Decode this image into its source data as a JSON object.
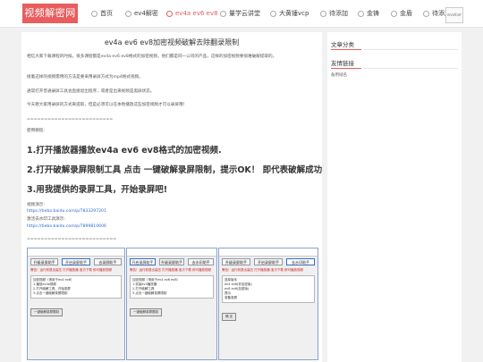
{
  "logo": "视频解密网",
  "nav": [
    "首页",
    "ev4解密",
    "ev4a ev6 ev8",
    "量学云讲堂",
    "大黄锤vcp",
    "待添加",
    "金铸",
    "金盾",
    "待添加"
  ],
  "avatar_alt": "avatar",
  "article": {
    "title": "ev4a ev6 ev8加密视频破解去除翻录限制",
    "para1": "相信大家下载课程的时候，很多课程都是ev4a ev6 ev8格式的加密视频，他们都是同一公司的产品，这样的加密视频要很难破解提取的。",
    "para2": "接着这样的视频需用的方法是要采用录屏方式为mp4格式视频。",
    "para3": "通常打开普通录屏工具会直接退出程序，或者是出来视频是黑屏状态。",
    "para4": "今天教大家用录屏的方式来提取，但是必须可以在本地播放这些加密视频才可以录屏哦！",
    "sep1": "=========================",
    "tutorial": "使用教程:",
    "step1": "1.打开播放器播放ev4a ev6 ev8格式的加密视频.",
    "step2": "2.打开破解录屏限制工具 点击 一键破解录屏限制，提示OK！ 即代表破解成功!",
    "step3": "3.用我提供的录屏工具，开始录屏吧!",
    "demo_label": "视频演示:",
    "demo_url": "https://tieba.baidu.com/p/7833297201",
    "tool_label": "激活去水印工具演示:",
    "tool_url": "https://tieba.baidu.com/p/7899810606",
    "sep2": "=========================="
  },
  "screens": [
    {
      "tabs": [
        "升级录屏助手",
        "开启录屏助手",
        "去录屏助手"
      ],
      "notice": "警告！运行前退出高压 打开播放器-宝贝下载 即可播放视频",
      "lines": [
        "加密视频（请用于ev4 ev6）",
        "1.播放ev4a视频",
        "2.打开破解工具，开始录屏",
        "3.点击一键破解录屏限制"
      ],
      "button": "一键破解录屏限制"
    },
    {
      "tabs": [
        "开启录屏助手",
        "升级录屏助手",
        "去水印助手"
      ],
      "notice": "警告！运行前退出高压 打开播放器-宝贝下载 即可播放视频",
      "lines": [
        "加密视频（请用于ev4 ev6 ev8）",
        "1.安装ev4播放器",
        "2.打开破解工具",
        "3.点击一键破解录屏限制"
      ],
      "button": "一键破解录屏限制"
    },
    {
      "tabs": [
        "升级录屏助手",
        "开启录屏助手",
        "去水印助手"
      ],
      "notice": "警告！运行前退出高压 打开播放器-宝贝下载 即可播放视频",
      "lines": [
        "选择版本",
        "ev4 ev6(非加密版)",
        "ev8 ev6(加密版)",
        "提示",
        "准备录屏"
      ],
      "button": "确 定"
    }
  ],
  "sidebar": {
    "section1": "文章分类",
    "section2": "友情链接",
    "link1": "备用域名"
  }
}
